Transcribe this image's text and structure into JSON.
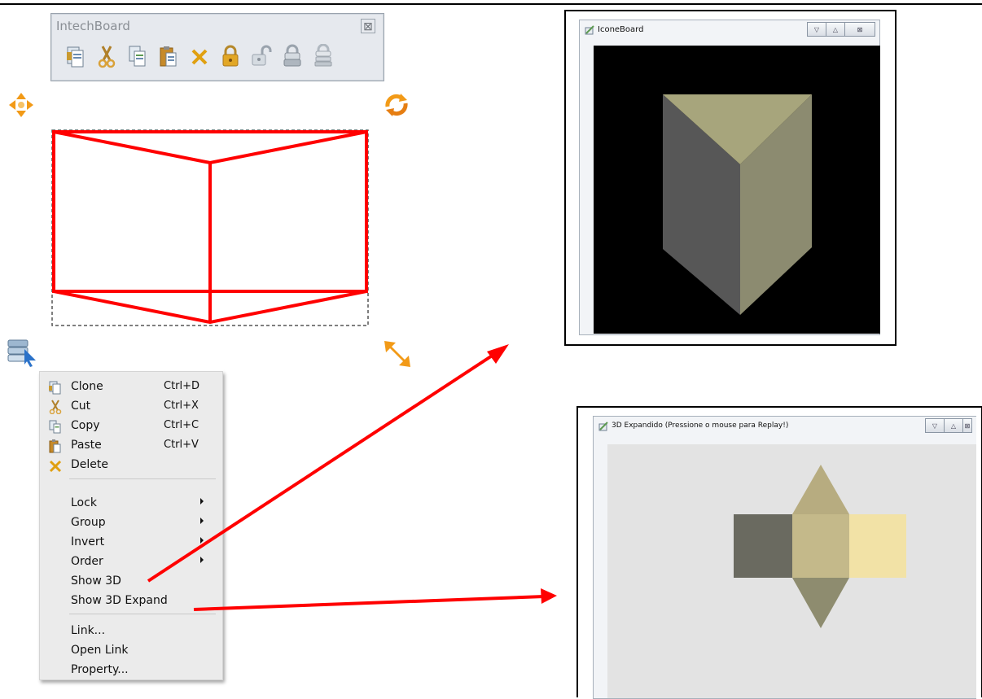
{
  "toolbar": {
    "title": "IntechBoard",
    "close_glyph": "⊠",
    "icons": [
      "clone-icon",
      "cut-icon",
      "copy-icon",
      "paste-icon",
      "delete-icon",
      "lock-icon",
      "unlock-icon",
      "group-icon",
      "ungroup-icon"
    ]
  },
  "handles": [
    "move-handle-icon",
    "rotate-handle-icon",
    "menu-handle-icon",
    "resize-handle-icon"
  ],
  "menu": {
    "items": [
      {
        "label": "Clone",
        "shortcut": "Ctrl+D",
        "icon": "clone-icon"
      },
      {
        "label": "Cut",
        "shortcut": "Ctrl+X",
        "icon": "cut-icon"
      },
      {
        "label": "Copy",
        "shortcut": "Ctrl+C",
        "icon": "copy-icon"
      },
      {
        "label": "Paste",
        "shortcut": "Ctrl+V",
        "icon": "paste-icon"
      },
      {
        "label": "Delete",
        "shortcut": "",
        "icon": "delete-icon"
      },
      {
        "label": "Lock",
        "submenu": true
      },
      {
        "label": "Group",
        "submenu": true
      },
      {
        "label": "Invert",
        "submenu": true
      },
      {
        "label": "Order",
        "submenu": true
      },
      {
        "label": "Show 3D"
      },
      {
        "label": "Show 3D Expand"
      },
      {
        "label": "Link..."
      },
      {
        "label": "Open Link"
      },
      {
        "label": "Property..."
      }
    ]
  },
  "window_3d": {
    "title": "IconeBoard",
    "buttons": [
      "▽",
      "△",
      "⊠"
    ],
    "colors": {
      "bg": "#000000",
      "top": "#a7a57c",
      "left": "#575757",
      "right": "#8c8b70"
    }
  },
  "window_expand": {
    "title": "3D Expandido (Pressione o mouse para Replay!)",
    "buttons": [
      "▽",
      "△",
      "⊠"
    ],
    "colors": {
      "bg": "#e3e3e3",
      "left": "#6a6a60",
      "center": "#c4b98a",
      "right": "#f2e2a6",
      "top": "#b7ac80",
      "bottom": "#8e8c6f"
    }
  },
  "accent": "#ff0000"
}
